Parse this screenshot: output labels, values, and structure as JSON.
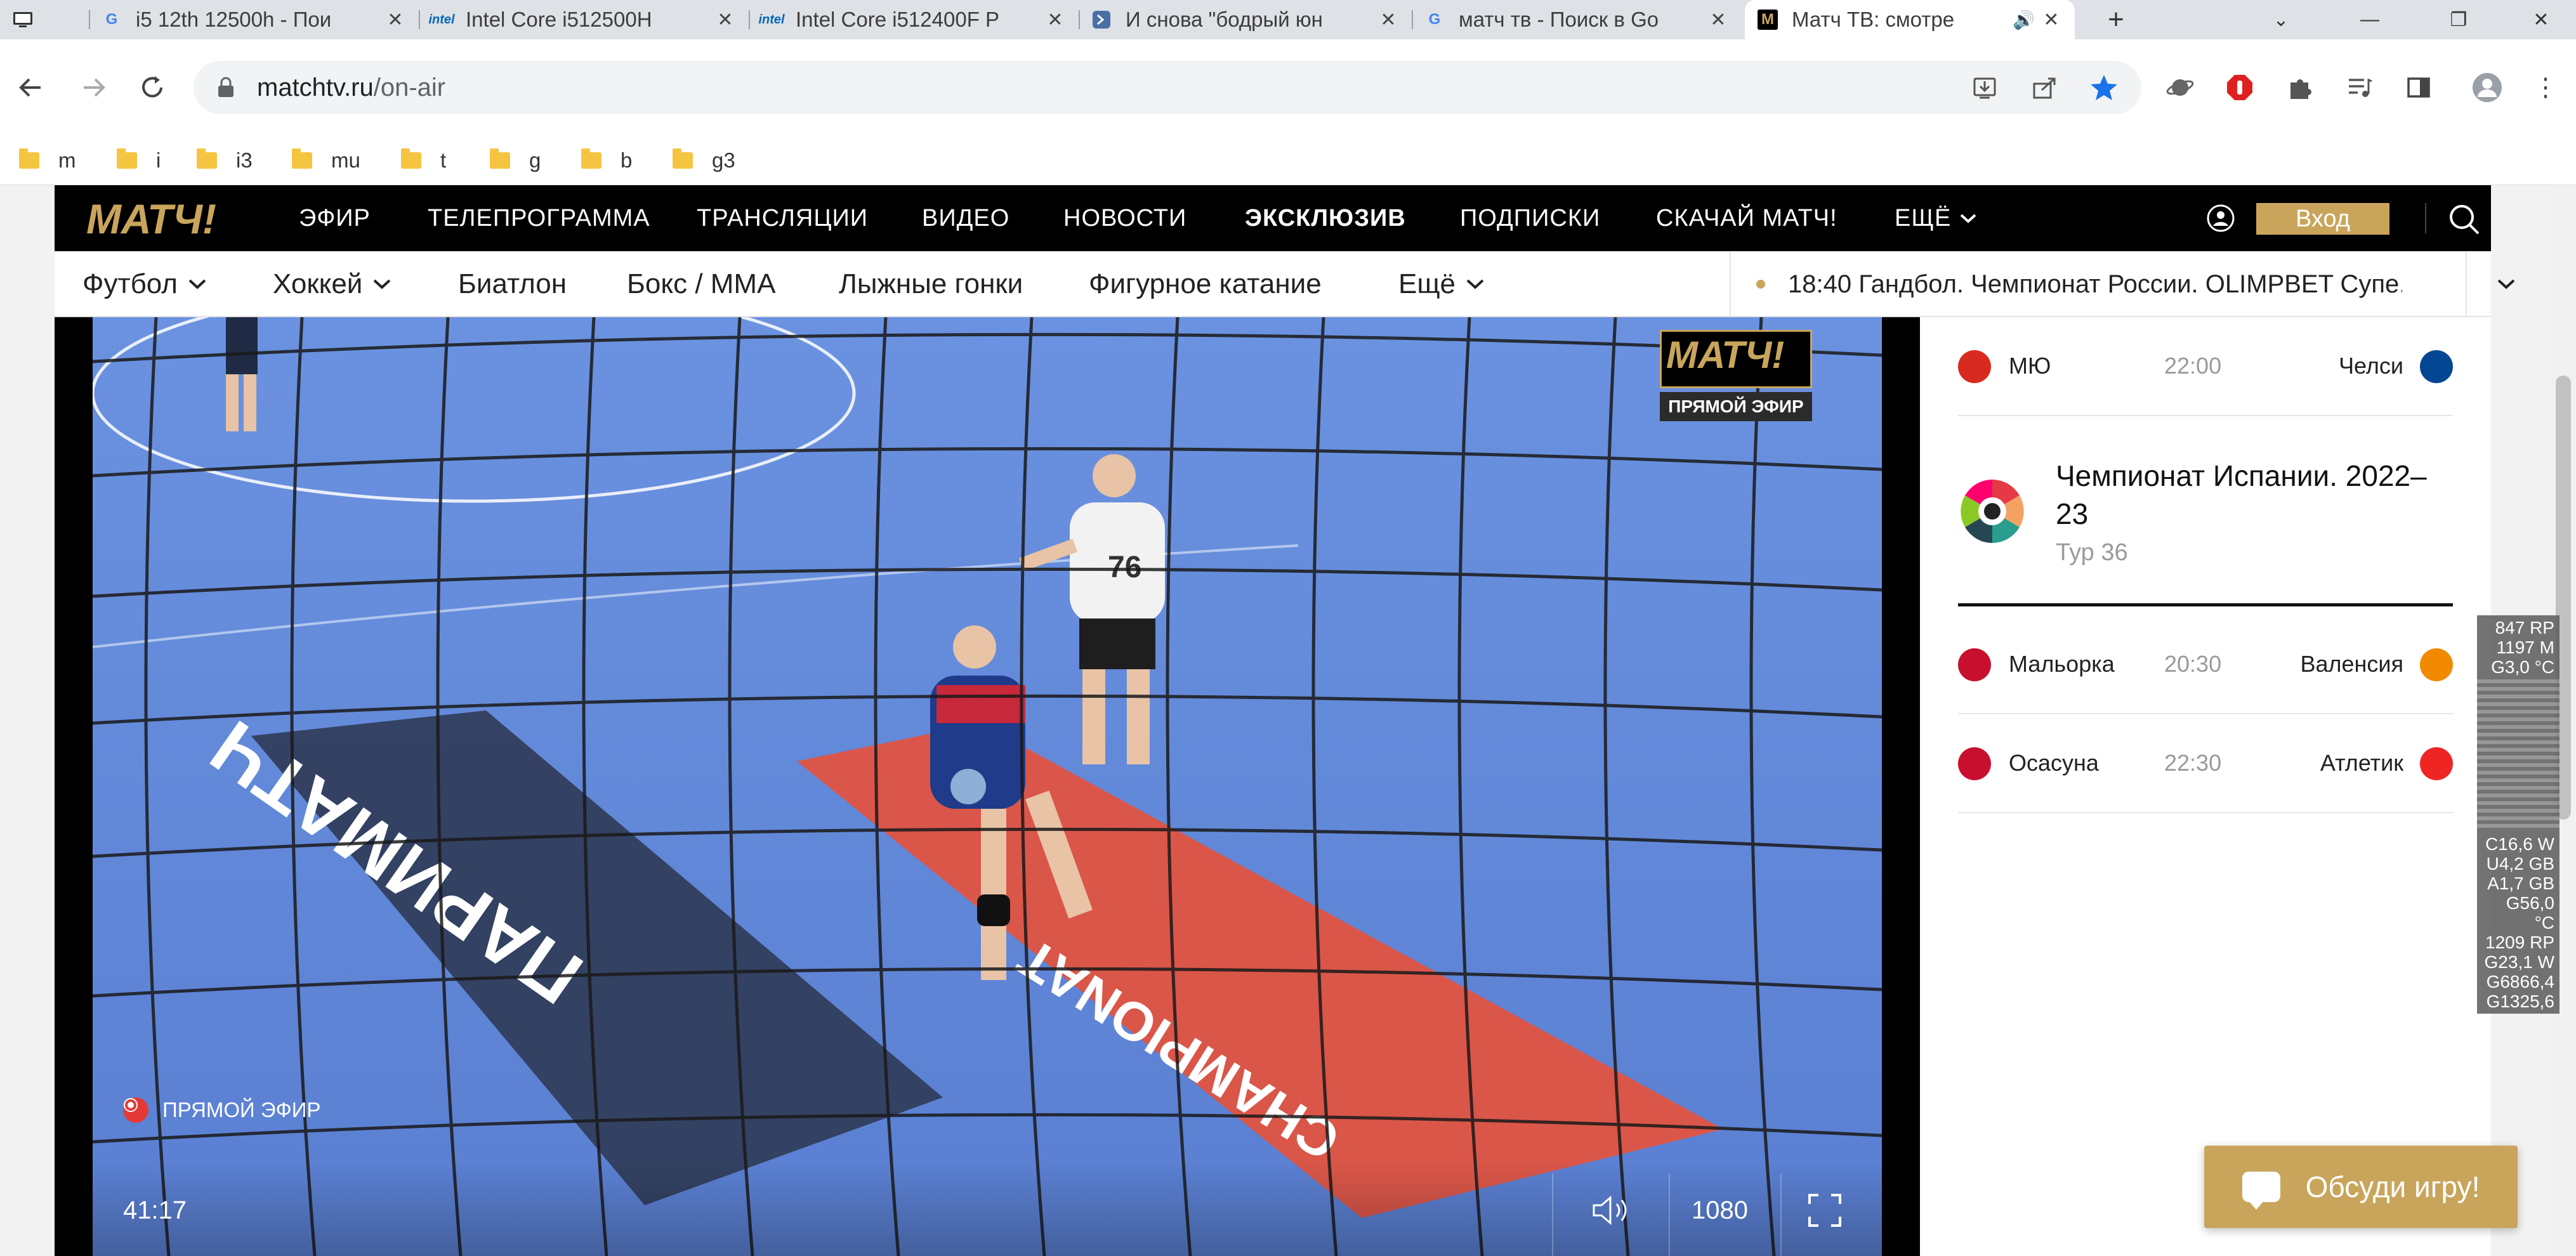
{
  "browser": {
    "tabs": [
      {
        "title": "i5 12th 12500h - Пои",
        "icon": "google-icon"
      },
      {
        "title": "Intel Core i512500H",
        "icon": "intel-icon"
      },
      {
        "title": "Intel Core i512400F P",
        "icon": "intel-icon"
      },
      {
        "title": "И снова \"бодрый юн",
        "icon": "habr-icon"
      },
      {
        "title": "матч тв - Поиск в Go",
        "icon": "google-icon"
      },
      {
        "title": "Матч ТВ: смотре",
        "icon": "matchtv-icon",
        "active": true
      }
    ],
    "url_host": "matchtv.ru",
    "url_path": "/on-air",
    "bookmarks": [
      "m",
      "i",
      "i3",
      "mu",
      "t",
      "g",
      "b",
      "g3"
    ]
  },
  "site": {
    "logo": "МАТЧ!",
    "nav": [
      "ЭФИР",
      "ТЕЛЕПРОГРАММА",
      "ТРАНСЛЯЦИИ",
      "ВИДЕО",
      "НОВОСТИ",
      "ЭКСКЛЮЗИВ",
      "ПОДПИСКИ",
      "СКАЧАЙ МАТЧ!",
      "ЕЩЁ"
    ],
    "login": "Вход",
    "sports": [
      "Футбол",
      "Хоккей",
      "Биатлон",
      "Бокс / ММА",
      "Лыжные гонки",
      "Фигурное катание",
      "Ещё"
    ],
    "ticker": "18:40 Гандбол. Чемпионат России. OLIMPBET Супе..."
  },
  "player": {
    "badge_logo": "МАТЧ!",
    "badge_caption": "ПРЯМОЙ ЭФИР",
    "live_label": "ПРЯМОЙ ЭФИР",
    "timecode": "41:17",
    "quality": "1080",
    "court_text_a": "CHAMPIONAT",
    "court_text_b": "ПАРИМАТЧ",
    "jersey_number": "76"
  },
  "schedule": {
    "top_match": {
      "home": "МЮ",
      "time": "22:00",
      "away": "Челси"
    },
    "league": {
      "title": "Чемпионат Испании. 2022–23",
      "round": "Тур 36"
    },
    "matches": [
      {
        "home": "Мальорка",
        "time": "20:30",
        "away": "Валенсия"
      },
      {
        "home": "Осасуна",
        "time": "22:30",
        "away": "Атлетик"
      }
    ]
  },
  "hwmon": {
    "top": [
      "847 RP",
      "1197 M",
      "G3,0 °C"
    ],
    "bottom": [
      "C16,6 W",
      "U4,2 GB",
      "A1,7 GB",
      "G56,0 °C",
      "1209 RP",
      "G23,1 W",
      "G6866,4",
      "G1325,6"
    ]
  },
  "discuss": "Обсуди игру!",
  "colors": {
    "gold": "#c9a55c",
    "court": "#5f86d8",
    "red_zone": "#e8513a"
  }
}
